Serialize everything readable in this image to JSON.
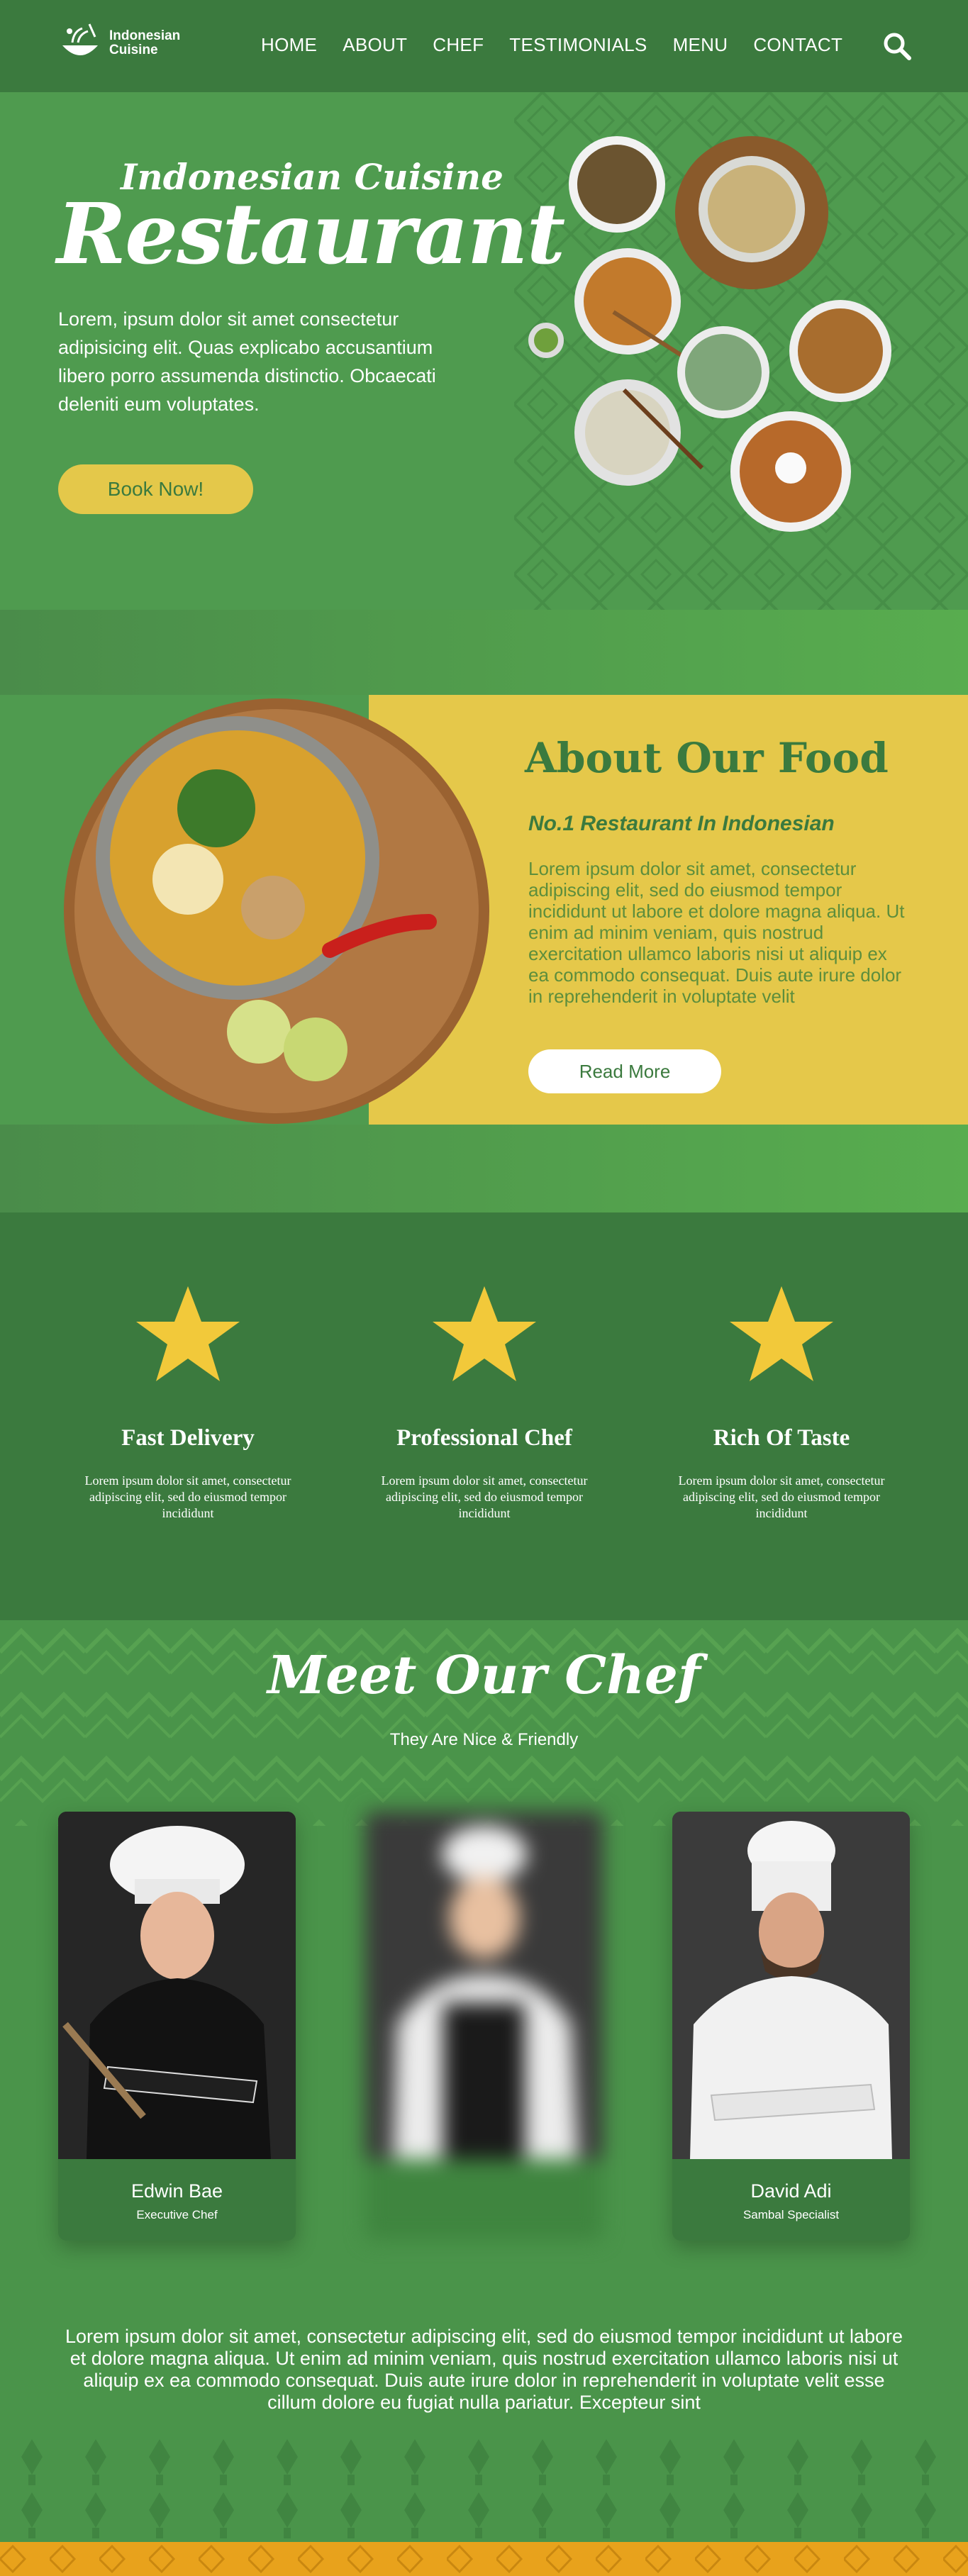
{
  "brand": {
    "name_line1": "Indonesian",
    "name_line2": "Cuisine"
  },
  "nav": {
    "items": [
      "HOME",
      "ABOUT",
      "CHEF",
      "TESTIMONIALS",
      "MENU",
      "CONTACT"
    ],
    "search_icon": "search-icon"
  },
  "hero": {
    "subtitle": "Indonesian Cuisine",
    "title": "Restaurant",
    "description": "Lorem, ipsum dolor sit amet consectetur adipisicing elit. Quas explicabo accusantium libero porro assumenda distinctio. Obcaecati deleniti eum voluptates.",
    "cta": "Book Now!"
  },
  "about": {
    "title": "About Our Food",
    "subtitle": "No.1 Restaurant In Indonesian",
    "text": "Lorem ipsum dolor sit amet, consectetur adipiscing elit, sed do eiusmod tempor incididunt ut labore et dolore magna aliqua. Ut enim ad minim veniam, quis nostrud exercitation ullamco laboris nisi ut aliquip ex ea commodo consequat. Duis aute irure dolor in reprehenderit in voluptate velit",
    "cta": "Read More"
  },
  "features": [
    {
      "title": "Fast Delivery",
      "text": "Lorem ipsum dolor sit amet, consectetur adipiscing elit, sed do eiusmod tempor incididunt"
    },
    {
      "title": "Professional Chef",
      "text": "Lorem ipsum dolor sit amet, consectetur adipiscing elit, sed do eiusmod tempor incididunt"
    },
    {
      "title": "Rich Of Taste",
      "text": "Lorem ipsum dolor sit amet, consectetur adipiscing elit, sed do eiusmod tempor incididunt"
    }
  ],
  "chefs": {
    "title": "Meet Our Chef",
    "subtitle": "They Are Nice & Friendly",
    "list": [
      {
        "name": "Edwin Bae",
        "role": "Executive Chef"
      },
      {
        "name": "",
        "role": ""
      },
      {
        "name": "David Adi",
        "role": "Sambal Specialist"
      }
    ],
    "paragraph": "Lorem ipsum dolor sit amet, consectetur adipiscing elit, sed do eiusmod tempor incididunt ut labore et dolore magna aliqua. Ut enim ad minim veniam, quis nostrud exercitation ullamco laboris nisi ut aliquip ex ea commodo consequat. Duis aute irure dolor in reprehenderit in voluptate velit esse cillum dolore eu fugiat nulla pariatur. Excepteur sint"
  },
  "colors": {
    "primary_green": "#3b7a3e",
    "hero_green": "#4f9b4f",
    "accent_yellow": "#e5c84a",
    "star_yellow": "#f2c93a",
    "footer_orange": "#e8a21c"
  }
}
